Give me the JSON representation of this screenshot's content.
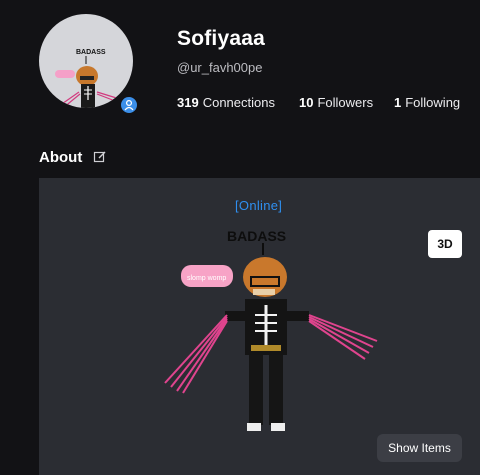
{
  "profile": {
    "display_name": "Sofiyaaa",
    "username": "@ur_favh00pe",
    "badge_icon": "person-icon"
  },
  "stats": [
    {
      "value": "319",
      "label": "Connections"
    },
    {
      "value": "10",
      "label": "Followers"
    },
    {
      "value": "1",
      "label": "Following"
    }
  ],
  "about": {
    "title": "About",
    "edit_icon": "edit-icon"
  },
  "stage": {
    "status": "[Online]",
    "view_toggle": "3D",
    "show_items": "Show Items",
    "avatar_hat_text": "BADASS",
    "avatar_bubble_text": "slomp womp"
  },
  "colors": {
    "background": "#121215",
    "stage": "#2b2d33",
    "online": "#2f8ff0",
    "badge": "#3b8fe9"
  }
}
